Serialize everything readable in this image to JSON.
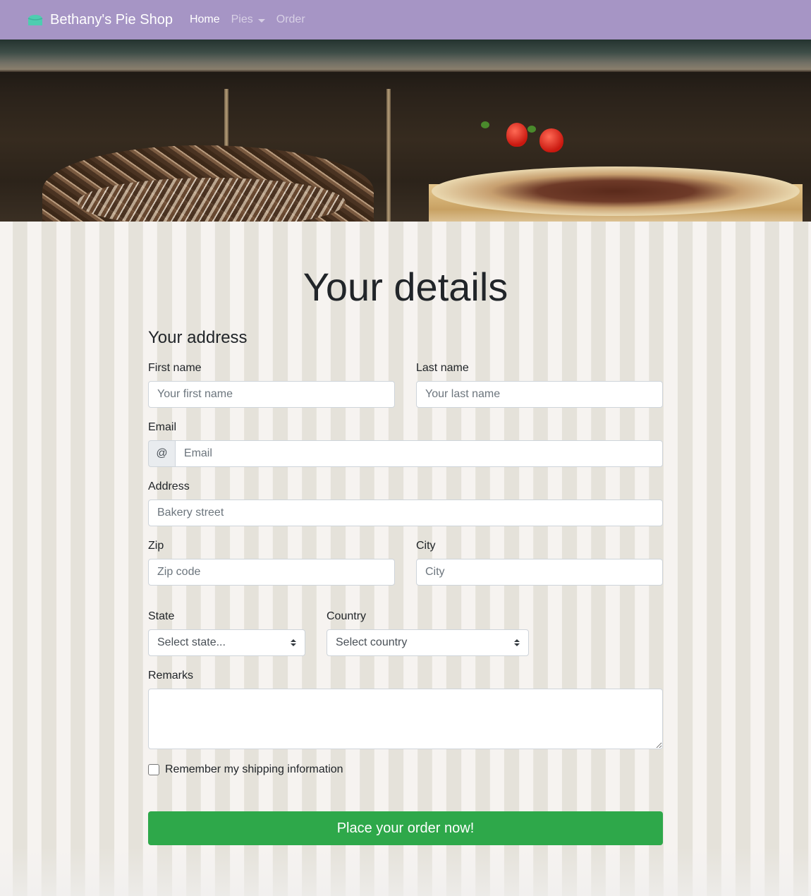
{
  "navbar": {
    "brand": "Bethany's Pie Shop",
    "brand_icon": "pie-icon",
    "brand_icon_color": "#4ecdb0",
    "background": "#a695c5",
    "links": [
      {
        "label": "Home",
        "active": true
      },
      {
        "label": "Pies",
        "dropdown": true
      },
      {
        "label": "Order"
      }
    ]
  },
  "hero": {
    "image": "cakes-in-display-case"
  },
  "page": {
    "title": "Your details",
    "section_title": "Your address"
  },
  "form": {
    "first_name": {
      "label": "First name",
      "placeholder": "Your first name",
      "value": ""
    },
    "last_name": {
      "label": "Last name",
      "placeholder": "Your last name",
      "value": ""
    },
    "email": {
      "label": "Email",
      "prefix": "@",
      "placeholder": "Email",
      "value": ""
    },
    "address": {
      "label": "Address",
      "placeholder": "Bakery street",
      "value": ""
    },
    "zip": {
      "label": "Zip",
      "placeholder": "Zip code",
      "value": ""
    },
    "city": {
      "label": "City",
      "placeholder": "City",
      "value": ""
    },
    "state": {
      "label": "State",
      "selected": "Select state..."
    },
    "country": {
      "label": "Country",
      "selected": "Select country"
    },
    "remarks": {
      "label": "Remarks",
      "value": ""
    },
    "remember": {
      "label": "Remember my shipping information",
      "checked": false
    },
    "submit": {
      "label": "Place your order now!",
      "color": "#2ea84a"
    }
  }
}
